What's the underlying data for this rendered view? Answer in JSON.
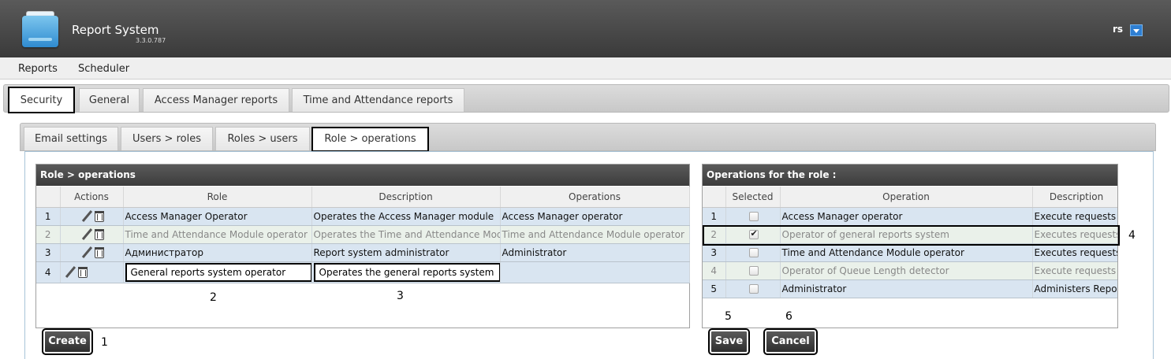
{
  "app": {
    "title": "Report System",
    "version": "3.3.0.787",
    "user": "rs"
  },
  "menu": [
    "Reports",
    "Scheduler"
  ],
  "tabs": [
    "Security",
    "General",
    "Access Manager reports",
    "Time and Attendance reports"
  ],
  "subtabs": [
    "Email settings",
    "Users > roles",
    "Roles > users",
    "Role > operations"
  ],
  "left_panel": {
    "title": "Role > operations",
    "columns": [
      "Actions",
      "Role",
      "Description",
      "Operations"
    ],
    "rows": [
      {
        "num": "1",
        "role": "Access Manager Operator",
        "description": "Operates the Access Manager module",
        "operations": "Access Manager operator"
      },
      {
        "num": "2",
        "role": "Time and Attendance Module operator",
        "description": "Operates the Time and Attendance Module",
        "operations": "Time and Attendance Module operator"
      },
      {
        "num": "3",
        "role": "Администратор",
        "description": "Report system administrator",
        "operations": "Administrator"
      },
      {
        "num": "4",
        "role": "General reports system operator",
        "description": "Operates the general reports system",
        "operations": ""
      }
    ],
    "create_label": "Create"
  },
  "right_panel": {
    "title": "Operations for the role :",
    "columns": [
      "Selected",
      "Operation",
      "Description"
    ],
    "rows": [
      {
        "num": "1",
        "selected": false,
        "operation": "Access Manager operator",
        "description": "Execute requests a"
      },
      {
        "num": "2",
        "selected": true,
        "operation": "Operator of general reports system",
        "description": "Executes requests a"
      },
      {
        "num": "3",
        "selected": false,
        "operation": "Time and Attendance Module operator",
        "description": "Executes requests a"
      },
      {
        "num": "4",
        "selected": false,
        "operation": "Operator of Queue Length detector",
        "description": "Execute requests a"
      },
      {
        "num": "5",
        "selected": false,
        "operation": "Administrator",
        "description": "Administers Report"
      }
    ],
    "save_label": "Save",
    "cancel_label": "Cancel"
  },
  "callouts": [
    "1",
    "2",
    "3",
    "4",
    "5",
    "6"
  ],
  "icons": {
    "logo": "folder-icon",
    "dropdown": "chevron-down-icon",
    "edit": "pencil-icon",
    "delete": "trash-icon"
  },
  "colors": {
    "header": "#3c3c3c",
    "row_blue": "#d9e5f1",
    "row_green": "#eaf1ea",
    "accent": "#2e7fd3"
  }
}
